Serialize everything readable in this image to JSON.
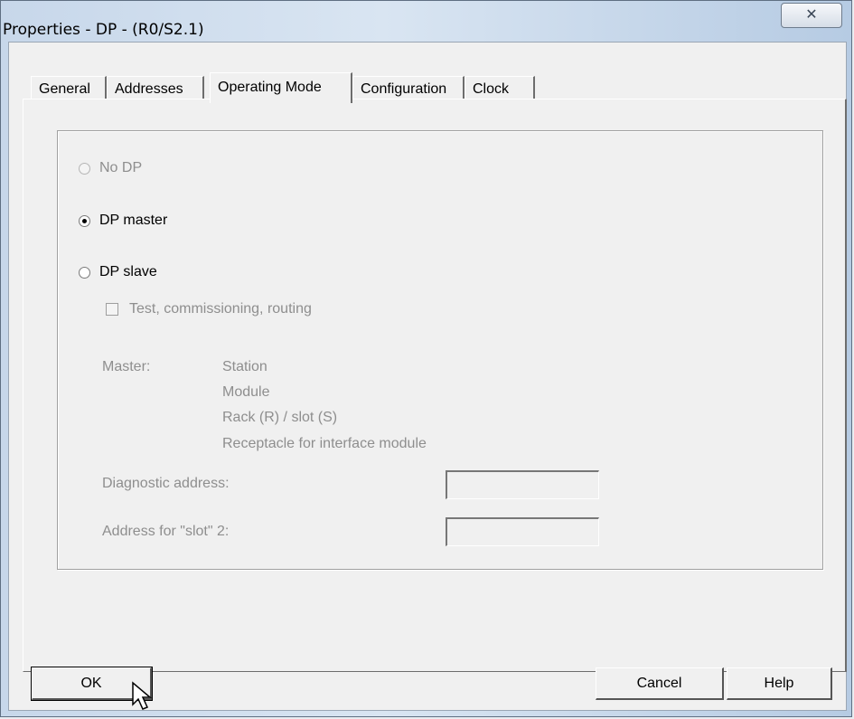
{
  "window": {
    "title": "Properties - DP - (R0/S2.1)",
    "close_label": "✕"
  },
  "tabs": [
    {
      "label": "General",
      "active": false
    },
    {
      "label": "Addresses",
      "active": false
    },
    {
      "label": "Operating Mode",
      "active": true
    },
    {
      "label": "Configuration",
      "active": false
    },
    {
      "label": "Clock",
      "active": false
    }
  ],
  "operating_mode": {
    "no_dp": {
      "label": "No DP",
      "checked": false,
      "enabled": false
    },
    "dp_master": {
      "label": "DP master",
      "checked": true,
      "enabled": true
    },
    "dp_slave": {
      "label": "DP slave",
      "checked": false,
      "enabled": true
    },
    "test_commissioning": {
      "label": "Test, commissioning, routing",
      "checked": false,
      "enabled": false
    },
    "master_label": "Master:",
    "master_details": [
      "Station",
      "Module",
      "Rack (R) / slot (S)",
      "Receptacle for interface module"
    ],
    "diagnostic_address": {
      "label": "Diagnostic address:",
      "value": ""
    },
    "slot2_address": {
      "label": "Address for \"slot\" 2:",
      "value": ""
    }
  },
  "buttons": {
    "ok": "OK",
    "cancel": "Cancel",
    "help": "Help"
  }
}
